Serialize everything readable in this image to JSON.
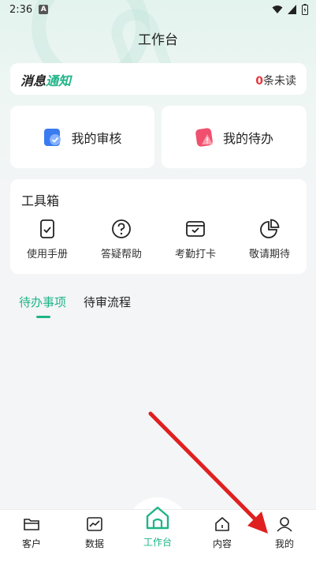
{
  "status": {
    "time": "2:36",
    "a_badge": "A"
  },
  "header": {
    "title": "工作台"
  },
  "message": {
    "title_part1": "消息",
    "title_part2": "通知",
    "unread_count": "0",
    "unread_suffix": "条未读"
  },
  "quick": {
    "review_label": "我的审核",
    "todo_label": "我的待办"
  },
  "toolbox": {
    "title": "工具箱",
    "items": [
      {
        "label": "使用手册",
        "icon": "manual-icon"
      },
      {
        "label": "答疑帮助",
        "icon": "help-icon"
      },
      {
        "label": "考勤打卡",
        "icon": "attendance-icon"
      },
      {
        "label": "敬请期待",
        "icon": "pie-chart-icon"
      }
    ]
  },
  "tabs": [
    {
      "label": "待办事项",
      "active": true
    },
    {
      "label": "待审流程",
      "active": false
    }
  ],
  "nav": [
    {
      "label": "客户",
      "icon": "folder-icon"
    },
    {
      "label": "数据",
      "icon": "chart-icon"
    },
    {
      "label": "工作台",
      "icon": "home-icon",
      "active": true
    },
    {
      "label": "内容",
      "icon": "house-icon"
    },
    {
      "label": "我的",
      "icon": "user-icon"
    }
  ],
  "colors": {
    "accent": "#1fb487",
    "unread": "#e8383d",
    "arrow": "#e02020"
  }
}
